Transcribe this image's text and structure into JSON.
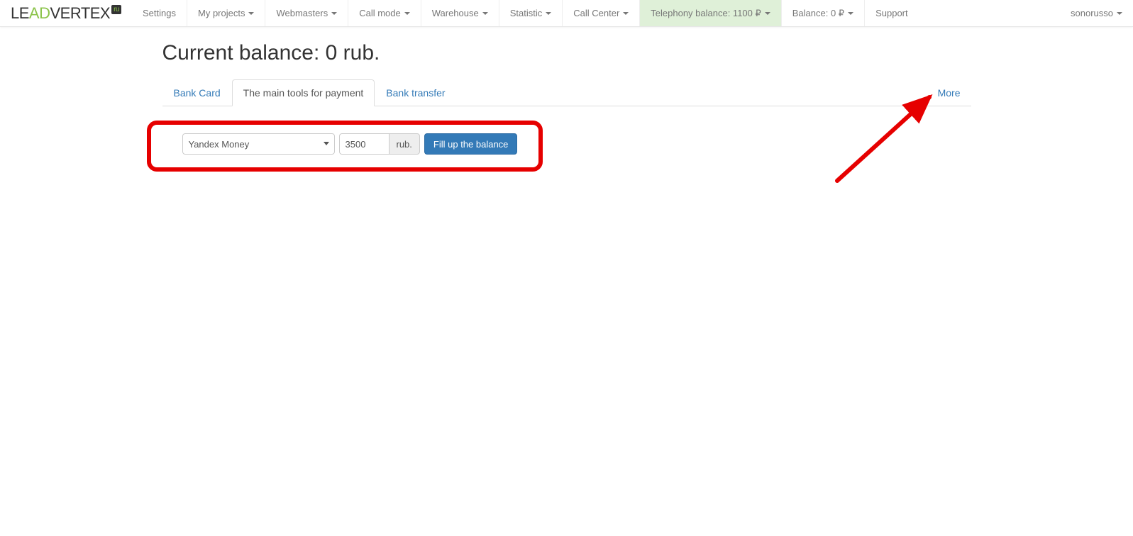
{
  "logo": {
    "le": "LE",
    "ad": "AD",
    "vertex": "VERTEX",
    "badge": "ru"
  },
  "nav": {
    "settings": "Settings",
    "my_projects": "My projects",
    "webmasters": "Webmasters",
    "call_mode": "Call mode",
    "warehouse": "Warehouse",
    "statistic": "Statistic",
    "call_center": "Call Center",
    "telephony_balance": "Telephony balance: 1100 ₽",
    "balance": "Balance: 0 ₽",
    "support": "Support",
    "user": "sonorusso"
  },
  "page": {
    "title": "Current balance: 0 rub."
  },
  "tabs": {
    "bank_card": "Bank Card",
    "main_tools": "The main tools for payment",
    "bank_transfer": "Bank transfer",
    "more": "More"
  },
  "form": {
    "payment_method": "Yandex Money",
    "amount": "3500",
    "currency_label": "rub.",
    "submit_label": "Fill up the balance"
  }
}
